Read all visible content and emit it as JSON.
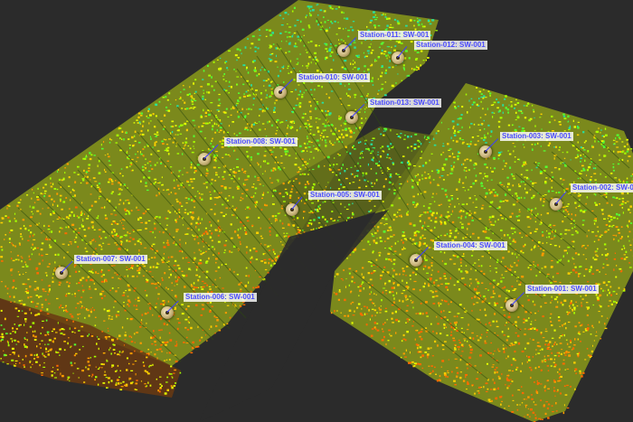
{
  "viewer": {
    "background_color": "#2b2b2b",
    "label_color": "#4a4aff",
    "cloud_colors": [
      "#ff6a00",
      "#ff9a00",
      "#ffd000",
      "#e6ff00",
      "#a6ff00",
      "#55ff33",
      "#27e0a0"
    ]
  },
  "stations": [
    {
      "id": "station-011",
      "label": "Station-011: SW-001"
    },
    {
      "id": "station-012",
      "label": "Station-012: SW-001"
    },
    {
      "id": "station-010",
      "label": "Station-010: SW-001"
    },
    {
      "id": "station-013",
      "label": "Station-013: SW-001"
    },
    {
      "id": "station-008",
      "label": "Station-008: SW-001"
    },
    {
      "id": "station-003",
      "label": "Station-003: SW-001"
    },
    {
      "id": "station-005",
      "label": "Station-005: SW-001"
    },
    {
      "id": "station-002",
      "label": "Station-002: SW-0"
    },
    {
      "id": "station-004",
      "label": "Station-004: SW-001"
    },
    {
      "id": "station-007",
      "label": "Station-007: SW-001"
    },
    {
      "id": "station-001",
      "label": "Station-001: SW-001"
    },
    {
      "id": "station-006",
      "label": "Station-006: SW-001"
    }
  ]
}
